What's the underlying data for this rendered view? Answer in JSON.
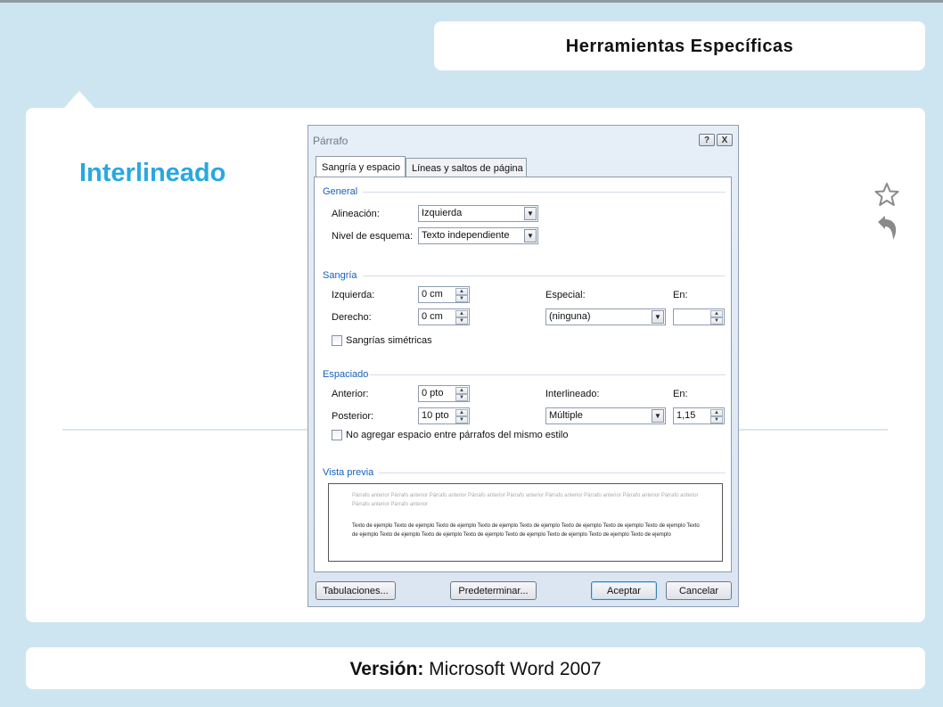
{
  "header": {
    "title": "Herramientas Específicas"
  },
  "section": {
    "title": "Interlineado"
  },
  "side_icons": [
    "star-icon",
    "undo-arrow-icon"
  ],
  "footer": {
    "label": "Versión:",
    "value": "Microsoft Word 2007"
  },
  "dialog": {
    "title": "Párrafo",
    "title_buttons": [
      "?",
      "X"
    ],
    "tabs": [
      "Sangría y espacio",
      "Líneas y saltos de página"
    ],
    "active_tab": "Sangría y espacio",
    "general": {
      "heading": "General",
      "alineacion_label": "Alineación:",
      "alineacion_value": "Izquierda",
      "nivel_label": "Nivel de esquema:",
      "nivel_value": "Texto independiente"
    },
    "sangria": {
      "heading": "Sangría",
      "izquierda_label": "Izquierda:",
      "izquierda_value": "0 cm",
      "derecho_label": "Derecho:",
      "derecho_value": "0 cm",
      "especial_label": "Especial:",
      "especial_value": "(ninguna)",
      "en_label": "En:",
      "en_value": "",
      "simetricas_label": "Sangrías simétricas"
    },
    "espaciado": {
      "heading": "Espaciado",
      "anterior_label": "Anterior:",
      "anterior_value": "0 pto",
      "posterior_label": "Posterior:",
      "posterior_value": "10 pto",
      "interlineado_label": "Interlineado:",
      "interlineado_value": "Múltiple",
      "en_label": "En:",
      "en_value": "1,15",
      "no_agregar_label": "No agregar espacio entre párrafos del mismo estilo"
    },
    "vista_previa": {
      "heading": "Vista previa",
      "previous_text": "Párrafo anterior Párrafo anterior Párrafo anterior Párrafo anterior Párrafo anterior Párrafo anterior Párrafo anterior Párrafo anterior Párrafo anterior Párrafo anterior Párrafo anterior",
      "sample_text": "Texto de ejemplo Texto de ejemplo Texto de ejemplo Texto de ejemplo Texto de ejemplo Texto de ejemplo Texto de ejemplo Texto de ejemplo Texto de ejemplo Texto de ejemplo Texto de ejemplo Texto de ejemplo Texto de ejemplo Texto de ejemplo Texto de ejemplo Texto de ejemplo"
    },
    "buttons": {
      "tabulaciones": "Tabulaciones...",
      "predeterminar": "Predeterminar...",
      "aceptar": "Aceptar",
      "cancelar": "Cancelar"
    }
  }
}
